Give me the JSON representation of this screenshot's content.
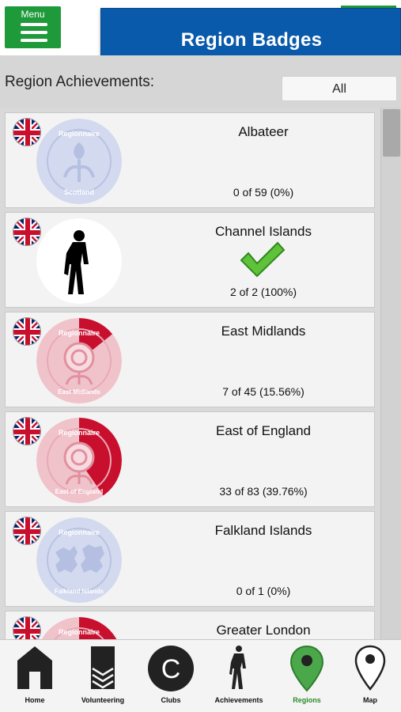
{
  "header": {
    "menu_label": "Menu",
    "title": "Region Badges"
  },
  "filter": {
    "label": "Region Achievements:",
    "selected": "All"
  },
  "regions": [
    {
      "name": "Albateer",
      "count": "0 of 59 (0%)",
      "badge_text_top": "Regionnaire",
      "badge_text_bottom": "Scotland",
      "badge_color": "#8f9fd0",
      "progress_pct": 0
    },
    {
      "name": "Channel Islands",
      "count": "2 of 2 (100%)",
      "badge_text_top": "",
      "badge_text_bottom": "",
      "badge_color": "#000000",
      "progress_pct": 100,
      "completed": true
    },
    {
      "name": "East Midlands",
      "count": "7 of 45 (15.56%)",
      "badge_text_top": "Regionnaire",
      "badge_text_bottom": "East Midlands",
      "badge_color": "#c8102e",
      "progress_pct": 15.56
    },
    {
      "name": "East of England",
      "count": "33 of 83 (39.76%)",
      "badge_text_top": "Regionnaire",
      "badge_text_bottom": "East of England",
      "badge_color": "#c8102e",
      "progress_pct": 39.76
    },
    {
      "name": "Falkland Islands",
      "count": "0 of 1 (0%)",
      "badge_text_top": "Regionnaire",
      "badge_text_bottom": "Falkland Islands",
      "badge_color": "#8f9fd0",
      "progress_pct": 0
    },
    {
      "name": "Greater London",
      "count": "",
      "badge_text_top": "Regionnaire",
      "badge_text_bottom": "",
      "badge_color": "#c8102e",
      "progress_pct": 30
    }
  ],
  "nav": [
    {
      "label": "Home",
      "icon": "home-icon"
    },
    {
      "label": "Volunteering",
      "icon": "volunteering-icon"
    },
    {
      "label": "Clubs",
      "icon": "clubs-icon",
      "glyph": "C"
    },
    {
      "label": "Achievements",
      "icon": "runner-icon"
    },
    {
      "label": "Regions",
      "icon": "map-pin-icon",
      "active": true
    },
    {
      "label": "Map",
      "icon": "map-icon"
    }
  ],
  "colors": {
    "brand_green": "#1f9a3a",
    "title_blue": "#0a5aab",
    "active_green": "#2a8a2a",
    "badge_red": "#c8102e",
    "badge_faded_blue": "#8f9fd0"
  }
}
